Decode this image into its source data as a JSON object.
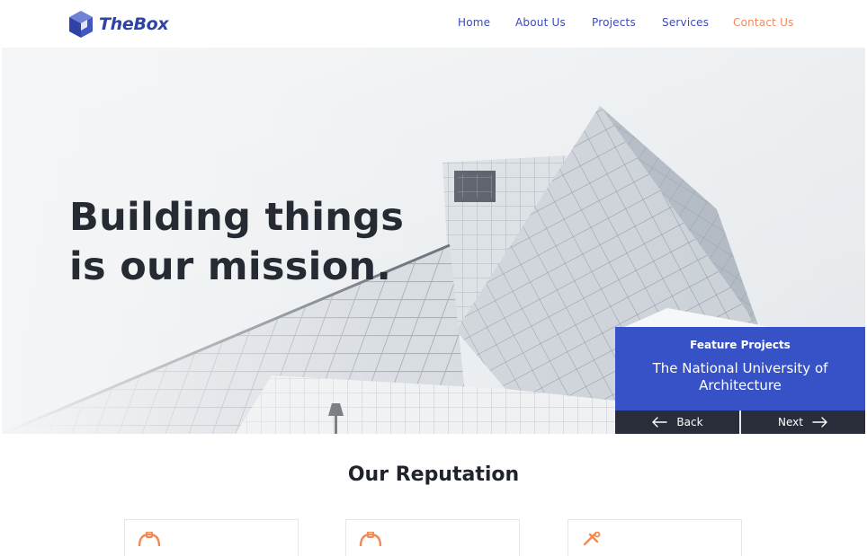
{
  "header": {
    "logo_text": "TheBox",
    "logo_icon": "cube-icon",
    "nav": [
      {
        "label": "Home",
        "active": false
      },
      {
        "label": "About Us",
        "active": false
      },
      {
        "label": "Projects",
        "active": false
      },
      {
        "label": "Services",
        "active": false
      },
      {
        "label": "Contact Us",
        "active": true
      }
    ]
  },
  "hero": {
    "title_line1": "Building things",
    "title_line2": "is our mission.",
    "feature": {
      "label": "Feature Projects",
      "name": "The National University of Architecture"
    },
    "back_label": "Back",
    "next_label": "Next"
  },
  "reputation": {
    "title": "Our Reputation",
    "cards": [
      {
        "icon": "helmet-icon"
      },
      {
        "icon": "helmet-icon"
      },
      {
        "icon": "tools-icon"
      }
    ]
  },
  "colors": {
    "brand": "#2f43a6",
    "nav_text": "#3b4ab8",
    "accent": "#f08a5d",
    "feature_bg": "#3752c7",
    "control_bg": "#282d39",
    "heading": "#262b33"
  }
}
